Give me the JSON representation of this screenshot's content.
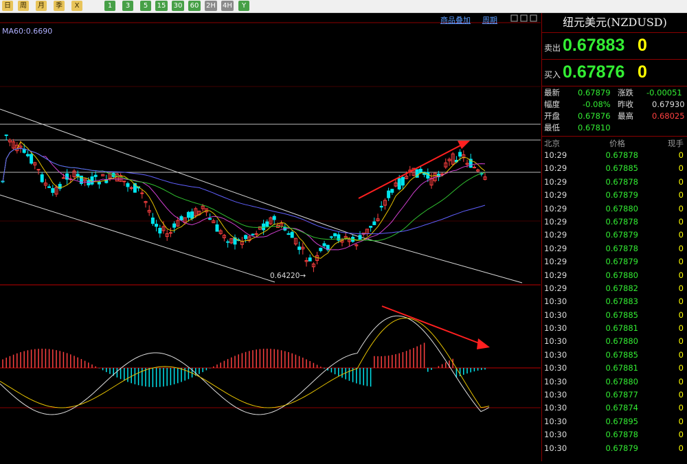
{
  "toolbar": {
    "buttons": [
      "日",
      "周",
      "月",
      "季",
      "X",
      "1",
      "3",
      "5",
      "15",
      "30",
      "60",
      "2H",
      "4H",
      "Y"
    ]
  },
  "chart": {
    "links": [
      "商品叠加",
      "周期"
    ],
    "ma_label": "MA60:0.6690",
    "low_label": "0.64220→"
  },
  "colors": {
    "up_candle": "#ff4040",
    "down_candle": "#00e5ee",
    "ma_yellow": "#e8c400",
    "ma_magenta": "#d040d0",
    "ma_green": "#30c030",
    "ma_blue": "#6060ff",
    "arrow": "#ff2020",
    "price_green": "#33ee33",
    "volume_yellow": "#ffff00"
  },
  "panel": {
    "title": "纽元美元(NZDUSD)",
    "sell_label": "卖出",
    "sell_price": "0.67883",
    "sell_size": "0",
    "buy_label": "买入",
    "buy_price": "0.67876",
    "buy_size": "0",
    "stats": {
      "latest_label": "最新",
      "latest": "0.67879",
      "change_label": "涨跌",
      "change": "-0.00051",
      "amp_label": "幅度",
      "amp": "-0.08%",
      "prev_label": "昨收",
      "prev": "0.67930",
      "open_label": "开盘",
      "open": "0.67876",
      "high_label": "最高",
      "high": "0.68025",
      "low_label": "最低",
      "low": "0.67810"
    },
    "tick_headers": [
      "北京",
      "价格",
      "现手"
    ],
    "ticks": [
      [
        "10:29",
        "0.67878",
        "0"
      ],
      [
        "10:29",
        "0.67885",
        "0"
      ],
      [
        "10:29",
        "0.67878",
        "0"
      ],
      [
        "10:29",
        "0.67879",
        "0"
      ],
      [
        "10:29",
        "0.67880",
        "0"
      ],
      [
        "10:29",
        "0.67878",
        "0"
      ],
      [
        "10:29",
        "0.67879",
        "0"
      ],
      [
        "10:29",
        "0.67878",
        "0"
      ],
      [
        "10:29",
        "0.67879",
        "0"
      ],
      [
        "10:29",
        "0.67880",
        "0"
      ],
      [
        "10:29",
        "0.67882",
        "0"
      ],
      [
        "10:30",
        "0.67883",
        "0"
      ],
      [
        "10:30",
        "0.67885",
        "0"
      ],
      [
        "10:30",
        "0.67881",
        "0"
      ],
      [
        "10:30",
        "0.67880",
        "0"
      ],
      [
        "10:30",
        "0.67885",
        "0"
      ],
      [
        "10:30",
        "0.67881",
        "0"
      ],
      [
        "10:30",
        "0.67880",
        "0"
      ],
      [
        "10:30",
        "0.67877",
        "0"
      ],
      [
        "10:30",
        "0.67874",
        "0"
      ],
      [
        "10:30",
        "0.67895",
        "0"
      ],
      [
        "10:30",
        "0.67878",
        "0"
      ],
      [
        "10:30",
        "0.67879",
        "0"
      ]
    ]
  }
}
